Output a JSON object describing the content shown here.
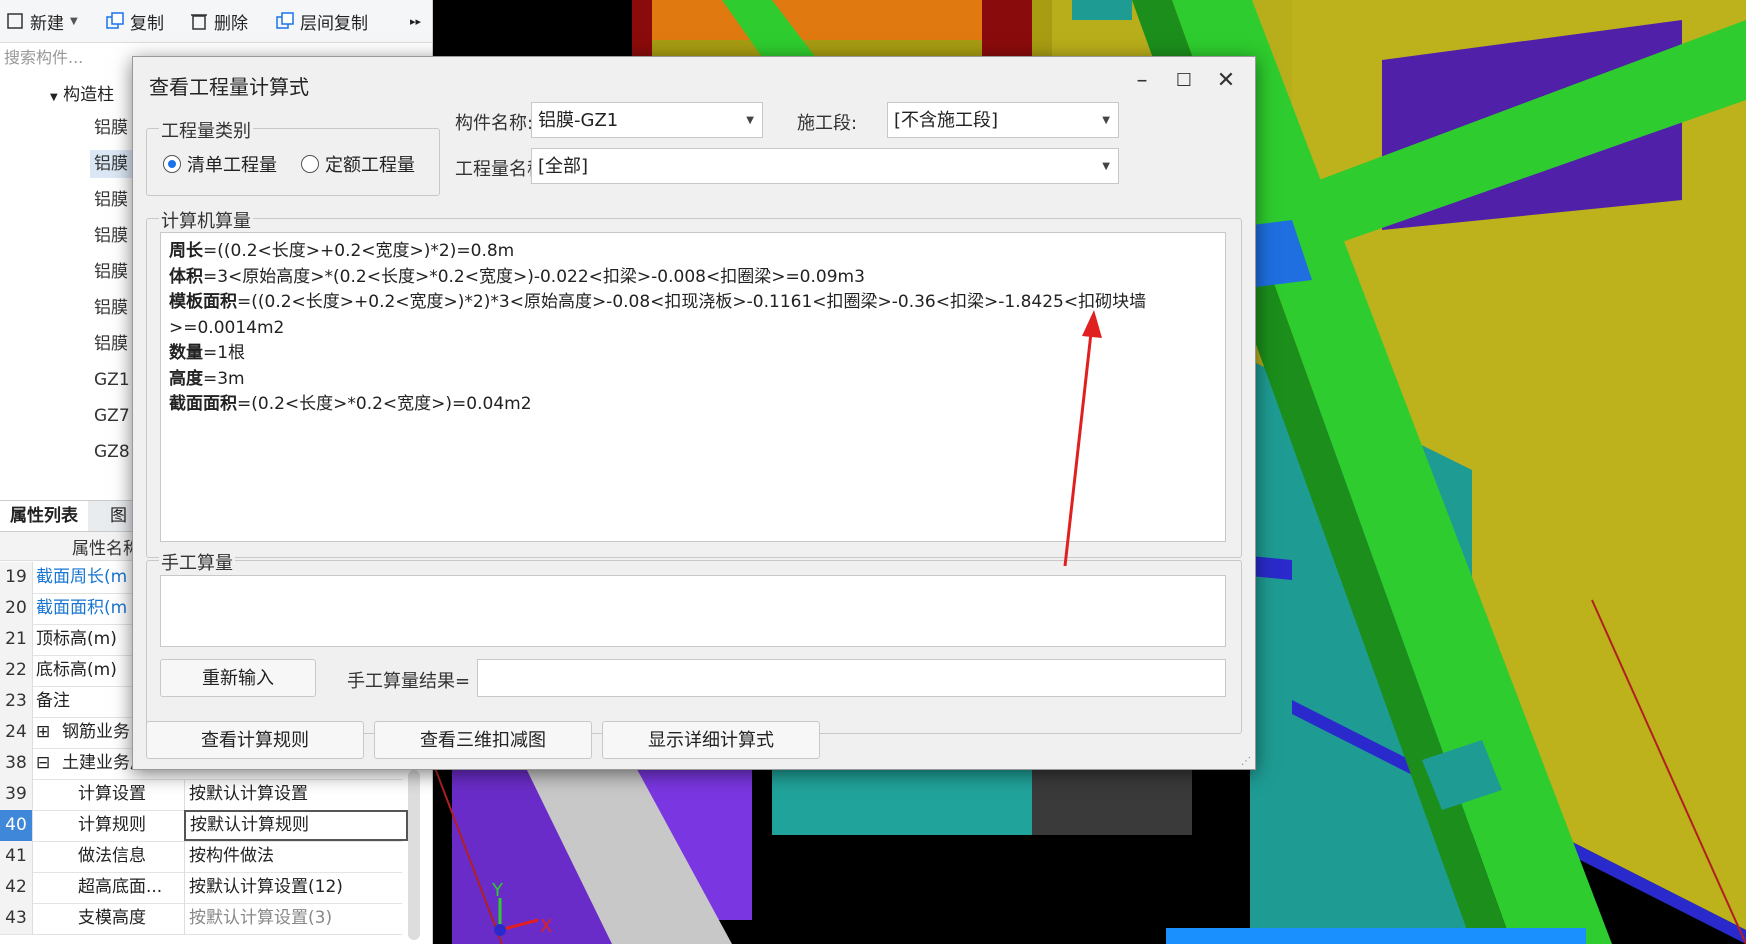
{
  "toolbar": {
    "new_label": "新建",
    "copy_label": "复制",
    "delete_label": "删除",
    "floor_copy_label": "层间复制",
    "more_label": "▸▸"
  },
  "search": {
    "placeholder": "搜索构件..."
  },
  "tree": {
    "group_label": "构造柱",
    "items": [
      "铝膜",
      "铝膜",
      "铝膜",
      "铝膜",
      "铝膜",
      "铝膜",
      "铝膜",
      "GZ1",
      "GZ7",
      "GZ8"
    ]
  },
  "panel_tabs": [
    "属性列表",
    "图"
  ],
  "grid": {
    "header_name": "属性名称",
    "rows": [
      {
        "num": "19",
        "name": "截面周长(m",
        "val": ""
      },
      {
        "num": "20",
        "name": "截面面积(m",
        "val": ""
      },
      {
        "num": "21",
        "name": "顶标高(m)",
        "val": ""
      },
      {
        "num": "22",
        "name": "底标高(m)",
        "val": ""
      },
      {
        "num": "23",
        "name": "备注",
        "val": ""
      },
      {
        "num": "24",
        "name": "钢筋业务",
        "val": ""
      },
      {
        "num": "38",
        "name": "土建业务属性",
        "val": ""
      },
      {
        "num": "39",
        "name": "计算设置",
        "val": "按默认计算设置"
      },
      {
        "num": "40",
        "name": "计算规则",
        "val": "按默认计算规则"
      },
      {
        "num": "41",
        "name": "做法信息",
        "val": "按构件做法"
      },
      {
        "num": "42",
        "name": "超高底面...",
        "val": "按默认计算设置(12)"
      },
      {
        "num": "43",
        "name": "支模高度",
        "val": "按默认计算设置(3)"
      }
    ]
  },
  "dialog": {
    "title": "查看工程量计算式",
    "qty_type_group": "工程量类别",
    "radio_bill": "清单工程量",
    "radio_quota": "定额工程量",
    "component_name_label": "构件名称:",
    "component_name_value": "铝膜-GZ1",
    "stage_label": "施工段:",
    "stage_value": "[不含施工段]",
    "qty_name_label": "工程量名称:",
    "qty_name_value": "[全部]",
    "computer_group": "计算机算量",
    "formulas": [
      {
        "name": "周长",
        "expr": "=((0.2<长度>+0.2<宽度>)*2)=0.8m"
      },
      {
        "name": "体积",
        "expr": "=3<原始高度>*(0.2<长度>*0.2<宽度>)-0.022<扣梁>-0.008<扣圈梁>=0.09m3"
      },
      {
        "name": "模板面积",
        "expr": "=((0.2<长度>+0.2<宽度>)*2)*3<原始高度>-0.08<扣现浇板>-0.1161<扣圈梁>-0.36<扣梁>-1.8425<扣砌块墙>=0.0014m2"
      },
      {
        "name": "数量",
        "expr": "=1根"
      },
      {
        "name": "高度",
        "expr": "=3m"
      },
      {
        "name": "截面面积",
        "expr": "=(0.2<长度>*0.2<宽度>)=0.04m2"
      }
    ],
    "manual_group": "手工算量",
    "reinput_button": "重新输入",
    "manual_result_label": "手工算量结果=",
    "view_rules_button": "查看计算规则",
    "view_3d_button": "查看三维扣减图",
    "show_detail_button": "显示详细计算式"
  },
  "axis": {
    "x": "X",
    "y": "Y"
  },
  "colors": {
    "accent": "#1a73e8",
    "annotation_arrow": "#e02020",
    "beam_green": "#2ecc2e",
    "wall_yellow": "#c8b820"
  }
}
